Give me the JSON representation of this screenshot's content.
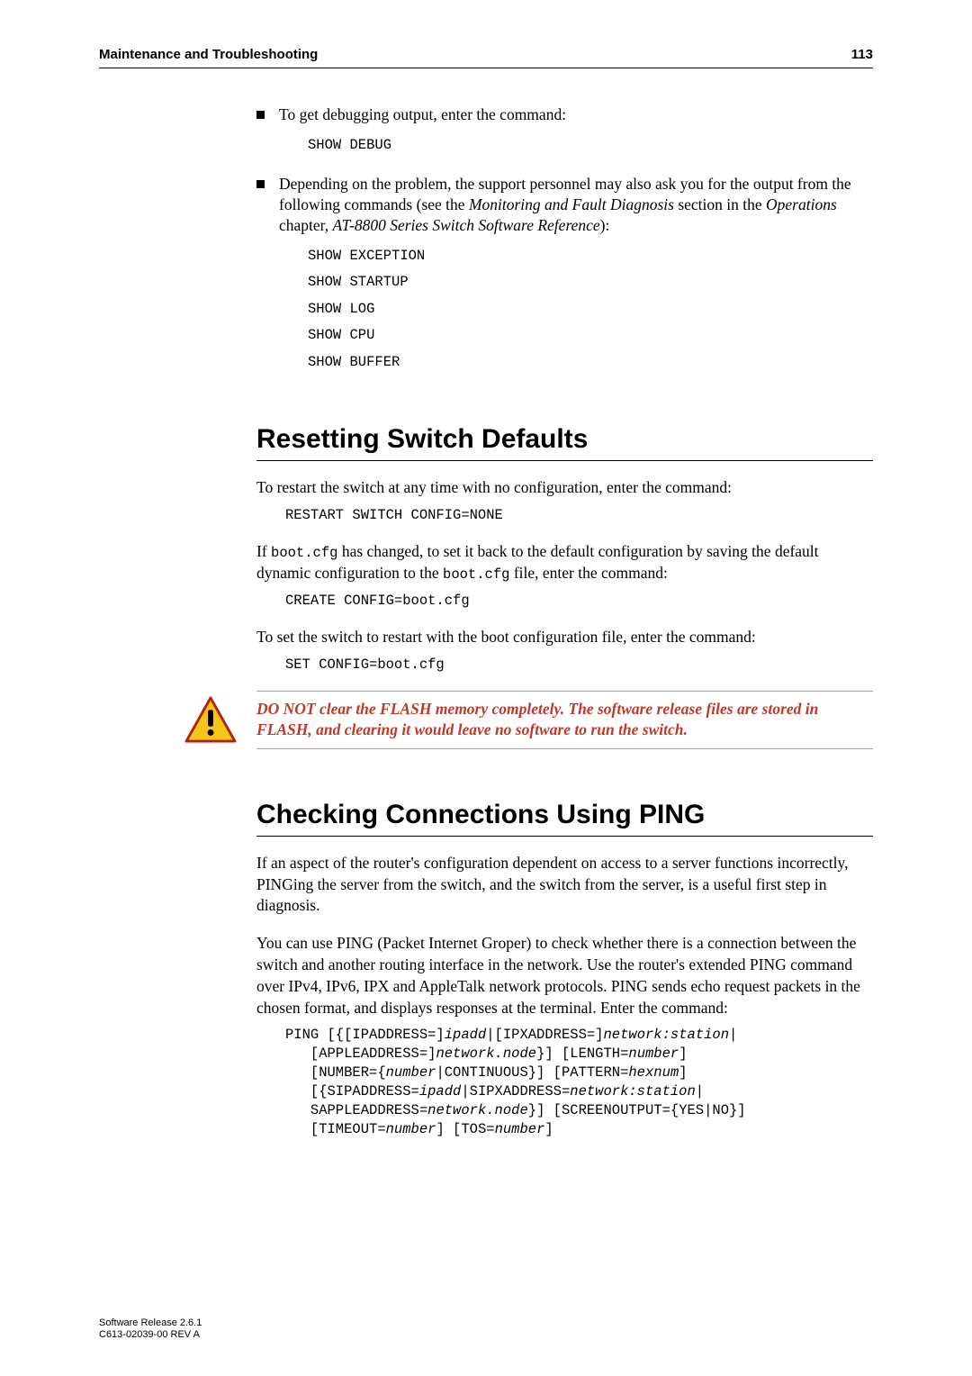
{
  "header": {
    "title": "Maintenance and Troubleshooting",
    "page": "113"
  },
  "bullet1": {
    "text": "To get debugging output, enter the command:",
    "code": "SHOW DEBUG"
  },
  "bullet2": {
    "pre": "Depending on the problem, the support personnel may also ask you for the output from the following commands (see the ",
    "i1": "Monitoring and Fault Diagnosis",
    "mid1": " section in the ",
    "i2": "Operations",
    "mid2": " chapter, ",
    "i3": "AT-8800 Series Switch Software Reference",
    "post": "):",
    "code": "SHOW EXCEPTION\nSHOW STARTUP\nSHOW LOG\nSHOW CPU\nSHOW BUFFER"
  },
  "section1": {
    "title": "Resetting Switch Defaults",
    "p1": "To restart the switch at any time with no configuration, enter the command:",
    "c1": "RESTART SWITCH CONFIG=NONE",
    "p2a": "If ",
    "p2code1": "boot.cfg",
    "p2b": " has changed, to set it back to the default configuration by saving the default dynamic configuration to the ",
    "p2code2": "boot.cfg",
    "p2c": " file, enter the command:",
    "c2": "CREATE CONFIG=boot.cfg",
    "p3": "To set the switch to restart with the boot configuration file, enter the command:",
    "c3": "SET CONFIG=boot.cfg",
    "warning": "DO NOT clear the FLASH memory completely. The software release files are stored in FLASH, and clearing it would leave no software to run the switch."
  },
  "section2": {
    "title": "Checking Connections Using PING",
    "p1": "If an aspect of the router's configuration dependent on access to a server functions incorrectly, PINGing the server from the switch, and the switch from the server, is a useful first step in diagnosis.",
    "p2": "You can use PING (Packet Internet Groper) to check whether there is a connection between the switch and another routing interface in the network. Use the router's extended PING command over IPv4, IPv6, IPX and AppleTalk network protocols. PING sends echo request packets in the chosen format, and displays responses at the terminal. Enter the command:"
  },
  "ping": {
    "l1a": "PING [{[IPADDRESS=]",
    "l1i1": "ipadd",
    "l1b": "|[IPXADDRESS=]",
    "l1i2": "network:station",
    "l1c": "|",
    "l2a": "   [APPLEADDRESS=]",
    "l2i1": "network.node",
    "l2b": "}] [LENGTH=",
    "l2i2": "number",
    "l2c": "]",
    "l3a": "   [NUMBER={",
    "l3i1": "number",
    "l3b": "|CONTINUOUS}] [PATTERN=",
    "l3i2": "hexnum",
    "l3c": "]",
    "l4a": "   [{SIPADDRESS=",
    "l4i1": "ipadd",
    "l4b": "|SIPXADDRESS=",
    "l4i2": "network:station",
    "l4c": "|",
    "l5a": "   SAPPLEADDRESS=",
    "l5i1": "network.node",
    "l5b": "}] [SCREENOUTPUT={YES|NO}]",
    "l6a": "   [TIMEOUT=",
    "l6i1": "number",
    "l6b": "] [TOS=",
    "l6i2": "number",
    "l6c": "]"
  },
  "footer": {
    "l1": "Software Release 2.6.1",
    "l2": "C613-02039-00 REV A"
  }
}
